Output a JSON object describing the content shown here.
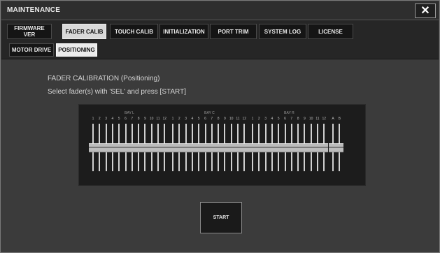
{
  "window": {
    "title": "MAINTENANCE",
    "close_icon": "close-icon"
  },
  "tabs": [
    {
      "label": "FIRMWARE\nVER",
      "active": false
    },
    {
      "label": "FADER CALIB",
      "active": true
    },
    {
      "label": "TOUCH CALIB",
      "active": false
    },
    {
      "label": "INITIALIZATION",
      "active": false
    },
    {
      "label": "PORT TRIM",
      "active": false
    },
    {
      "label": "SYSTEM LOG",
      "active": false
    },
    {
      "label": "LICENSE",
      "active": false
    }
  ],
  "subtabs": [
    {
      "label": "MOTOR DRIVE",
      "active": false
    },
    {
      "label": "POSITIONING",
      "active": true
    }
  ],
  "instructions": {
    "line1": "FADER CALIBRATION (Positioning)",
    "line2": "Select fader(s) with 'SEL' and press [START]"
  },
  "bays": [
    {
      "label": "BAY L",
      "channels": [
        "1",
        "2",
        "3",
        "4",
        "5",
        "6",
        "7",
        "8",
        "9",
        "10",
        "11",
        "12"
      ]
    },
    {
      "label": "BAY C",
      "channels": [
        "1",
        "2",
        "3",
        "4",
        "5",
        "6",
        "7",
        "8",
        "9",
        "10",
        "11",
        "12"
      ]
    },
    {
      "label": "BAY R",
      "channels": [
        "1",
        "2",
        "3",
        "4",
        "5",
        "6",
        "7",
        "8",
        "9",
        "10",
        "11",
        "12"
      ]
    },
    {
      "label": "",
      "channels": [
        "A",
        "B"
      ]
    }
  ],
  "start_button": {
    "label": "START"
  },
  "colors": {
    "active_tab": "#d9d9d9",
    "background": "#3b3b3b",
    "fader_panel": "#1c1c1c"
  }
}
